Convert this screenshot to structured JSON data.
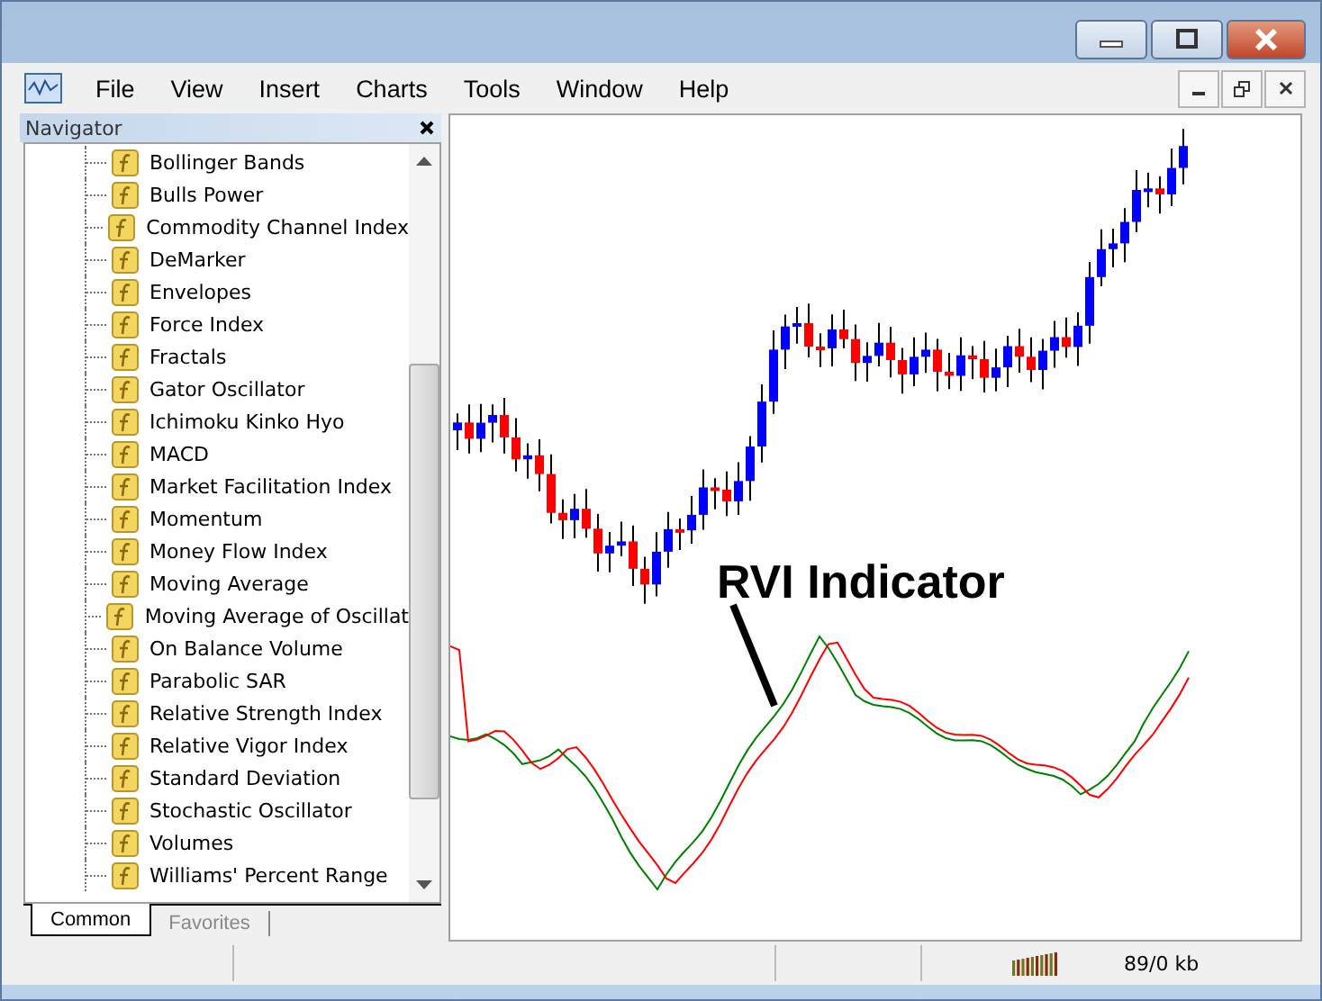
{
  "menu": [
    "File",
    "View",
    "Insert",
    "Charts",
    "Tools",
    "Window",
    "Help"
  ],
  "navigator": {
    "title": "Navigator",
    "items": [
      "Bollinger Bands",
      "Bulls Power",
      "Commodity Channel Index",
      "DeMarker",
      "Envelopes",
      "Force Index",
      "Fractals",
      "Gator Oscillator",
      "Ichimoku Kinko Hyo",
      "MACD",
      "Market Facilitation Index",
      "Momentum",
      "Money Flow Index",
      "Moving Average",
      "Moving Average of Oscillat",
      "On Balance Volume",
      "Parabolic SAR",
      "Relative Strength Index",
      "Relative Vigor Index",
      "Standard Deviation",
      "Stochastic Oscillator",
      "Volumes",
      "Williams' Percent Range"
    ],
    "tabs": [
      {
        "label": "Common",
        "selected": true
      },
      {
        "label": "Favorites",
        "selected": false
      }
    ]
  },
  "chart": {
    "annotation": "RVI Indicator"
  },
  "status_bar": {
    "traffic": "89/0 kb"
  }
}
